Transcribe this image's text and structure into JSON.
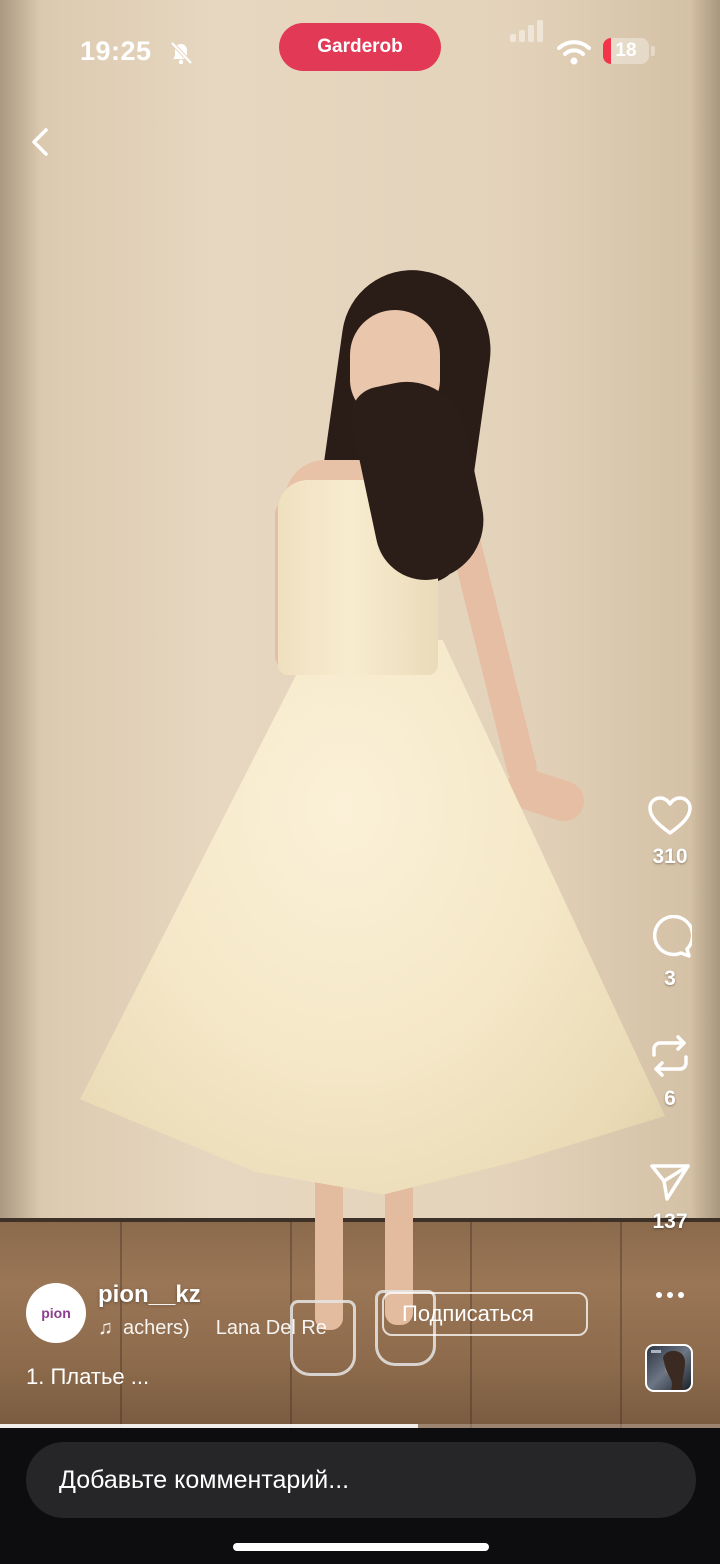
{
  "status_bar": {
    "time": "19:25",
    "app_name": "Garderob",
    "battery_level": "18",
    "battery_fraction": 0.18,
    "icons": [
      "bell-slash-icon",
      "signal-icon",
      "wifi-icon",
      "battery-icon"
    ]
  },
  "navigation": {
    "back_icon": "chevron-left-icon"
  },
  "actions": {
    "like_count": "310",
    "comment_count": "3",
    "repost_count": "6",
    "share_count": "137"
  },
  "post": {
    "avatar_text": "pion",
    "username": "pion__kz",
    "music_track": "achers)",
    "music_artist": "Lana Del Re",
    "follow_label": "Подписаться",
    "caption": "1. Платье ..."
  },
  "playback": {
    "progress_fraction": 0.58
  },
  "composer": {
    "placeholder": "Добавьте комментарий..."
  },
  "colors": {
    "app_pill": "#e23a56",
    "battery_low": "#f2334a",
    "composer_bg": "#0d0d0f",
    "input_bg": "#262628"
  }
}
